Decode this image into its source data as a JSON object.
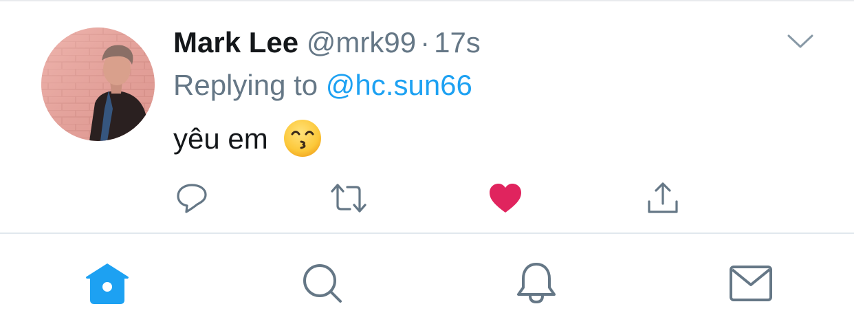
{
  "tweet": {
    "display_name": "Mark Lee",
    "handle": "@mrk99",
    "separator": "·",
    "timestamp": "17s",
    "replying_prefix": "Replying to",
    "replying_to": "@hc.sun66",
    "text": "yêu em",
    "emoji": "kissing-face-with-smiling-eyes",
    "liked": true
  },
  "icons": {
    "reply": "reply-icon",
    "retweet": "retweet-icon",
    "like": "heart-icon",
    "share": "share-icon",
    "caret": "chevron-down-icon"
  },
  "tabbar": {
    "items": [
      {
        "name": "home",
        "icon": "home-icon",
        "active": true
      },
      {
        "name": "search",
        "icon": "search-icon",
        "active": false
      },
      {
        "name": "notifications",
        "icon": "bell-icon",
        "active": false
      },
      {
        "name": "messages",
        "icon": "mail-icon",
        "active": false
      }
    ]
  },
  "colors": {
    "accent": "#1da1f2",
    "like": "#e0245e",
    "muted": "#657786",
    "text": "#14171a",
    "divider": "#e1e8ed"
  }
}
